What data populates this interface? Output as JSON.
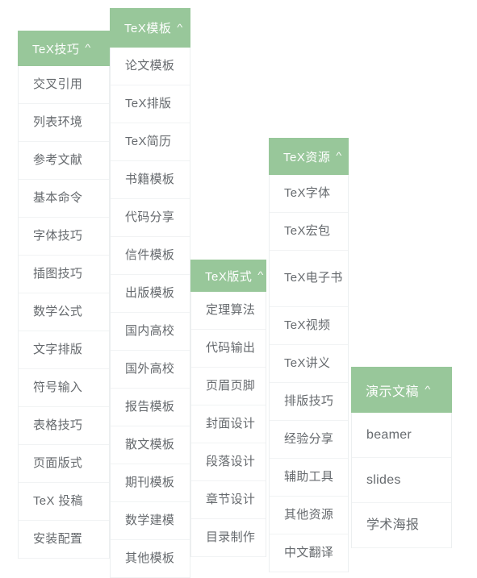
{
  "theme": {
    "accent_green": "#98c79a",
    "header_text": "#ffffff",
    "item_text": "#666a6e",
    "divider": "#f1f3f4",
    "background": "#ffffff"
  },
  "menu": {
    "caret_glyph": "^",
    "columns": [
      {
        "id": "tex-jiqiao",
        "title": "TeX技巧",
        "items": [
          "交叉引用",
          "列表环境",
          "参考文献",
          "基本命令",
          "字体技巧",
          "插图技巧",
          "数学公式",
          "文字排版",
          "符号输入",
          "表格技巧",
          "页面版式",
          "TeX 投稿",
          "安装配置"
        ]
      },
      {
        "id": "tex-moban",
        "title": "TeX模板",
        "items": [
          "论文模板",
          "TeX排版",
          "TeX简历",
          "书籍模板",
          "代码分享",
          "信件模板",
          "出版模板",
          "国内高校",
          "国外高校",
          "报告模板",
          "散文模板",
          "期刊模板",
          "数学建模",
          "其他模板"
        ]
      },
      {
        "id": "tex-banshi",
        "title": "TeX版式",
        "items": [
          "定理算法",
          "代码输出",
          "页眉页脚",
          "封面设计",
          "段落设计",
          "章节设计",
          "目录制作"
        ]
      },
      {
        "id": "tex-ziyuan",
        "title": "TeX资源",
        "items": [
          "TeX字体",
          "TeX宏包",
          "TeX电子书",
          "TeX视频",
          "TeX讲义",
          "排版技巧",
          "经验分享",
          "辅助工具",
          "其他资源",
          "中文翻译"
        ]
      },
      {
        "id": "yanshi-wengao",
        "title": "演示文稿",
        "items": [
          "beamer",
          "slides",
          "学术海报"
        ]
      }
    ]
  }
}
